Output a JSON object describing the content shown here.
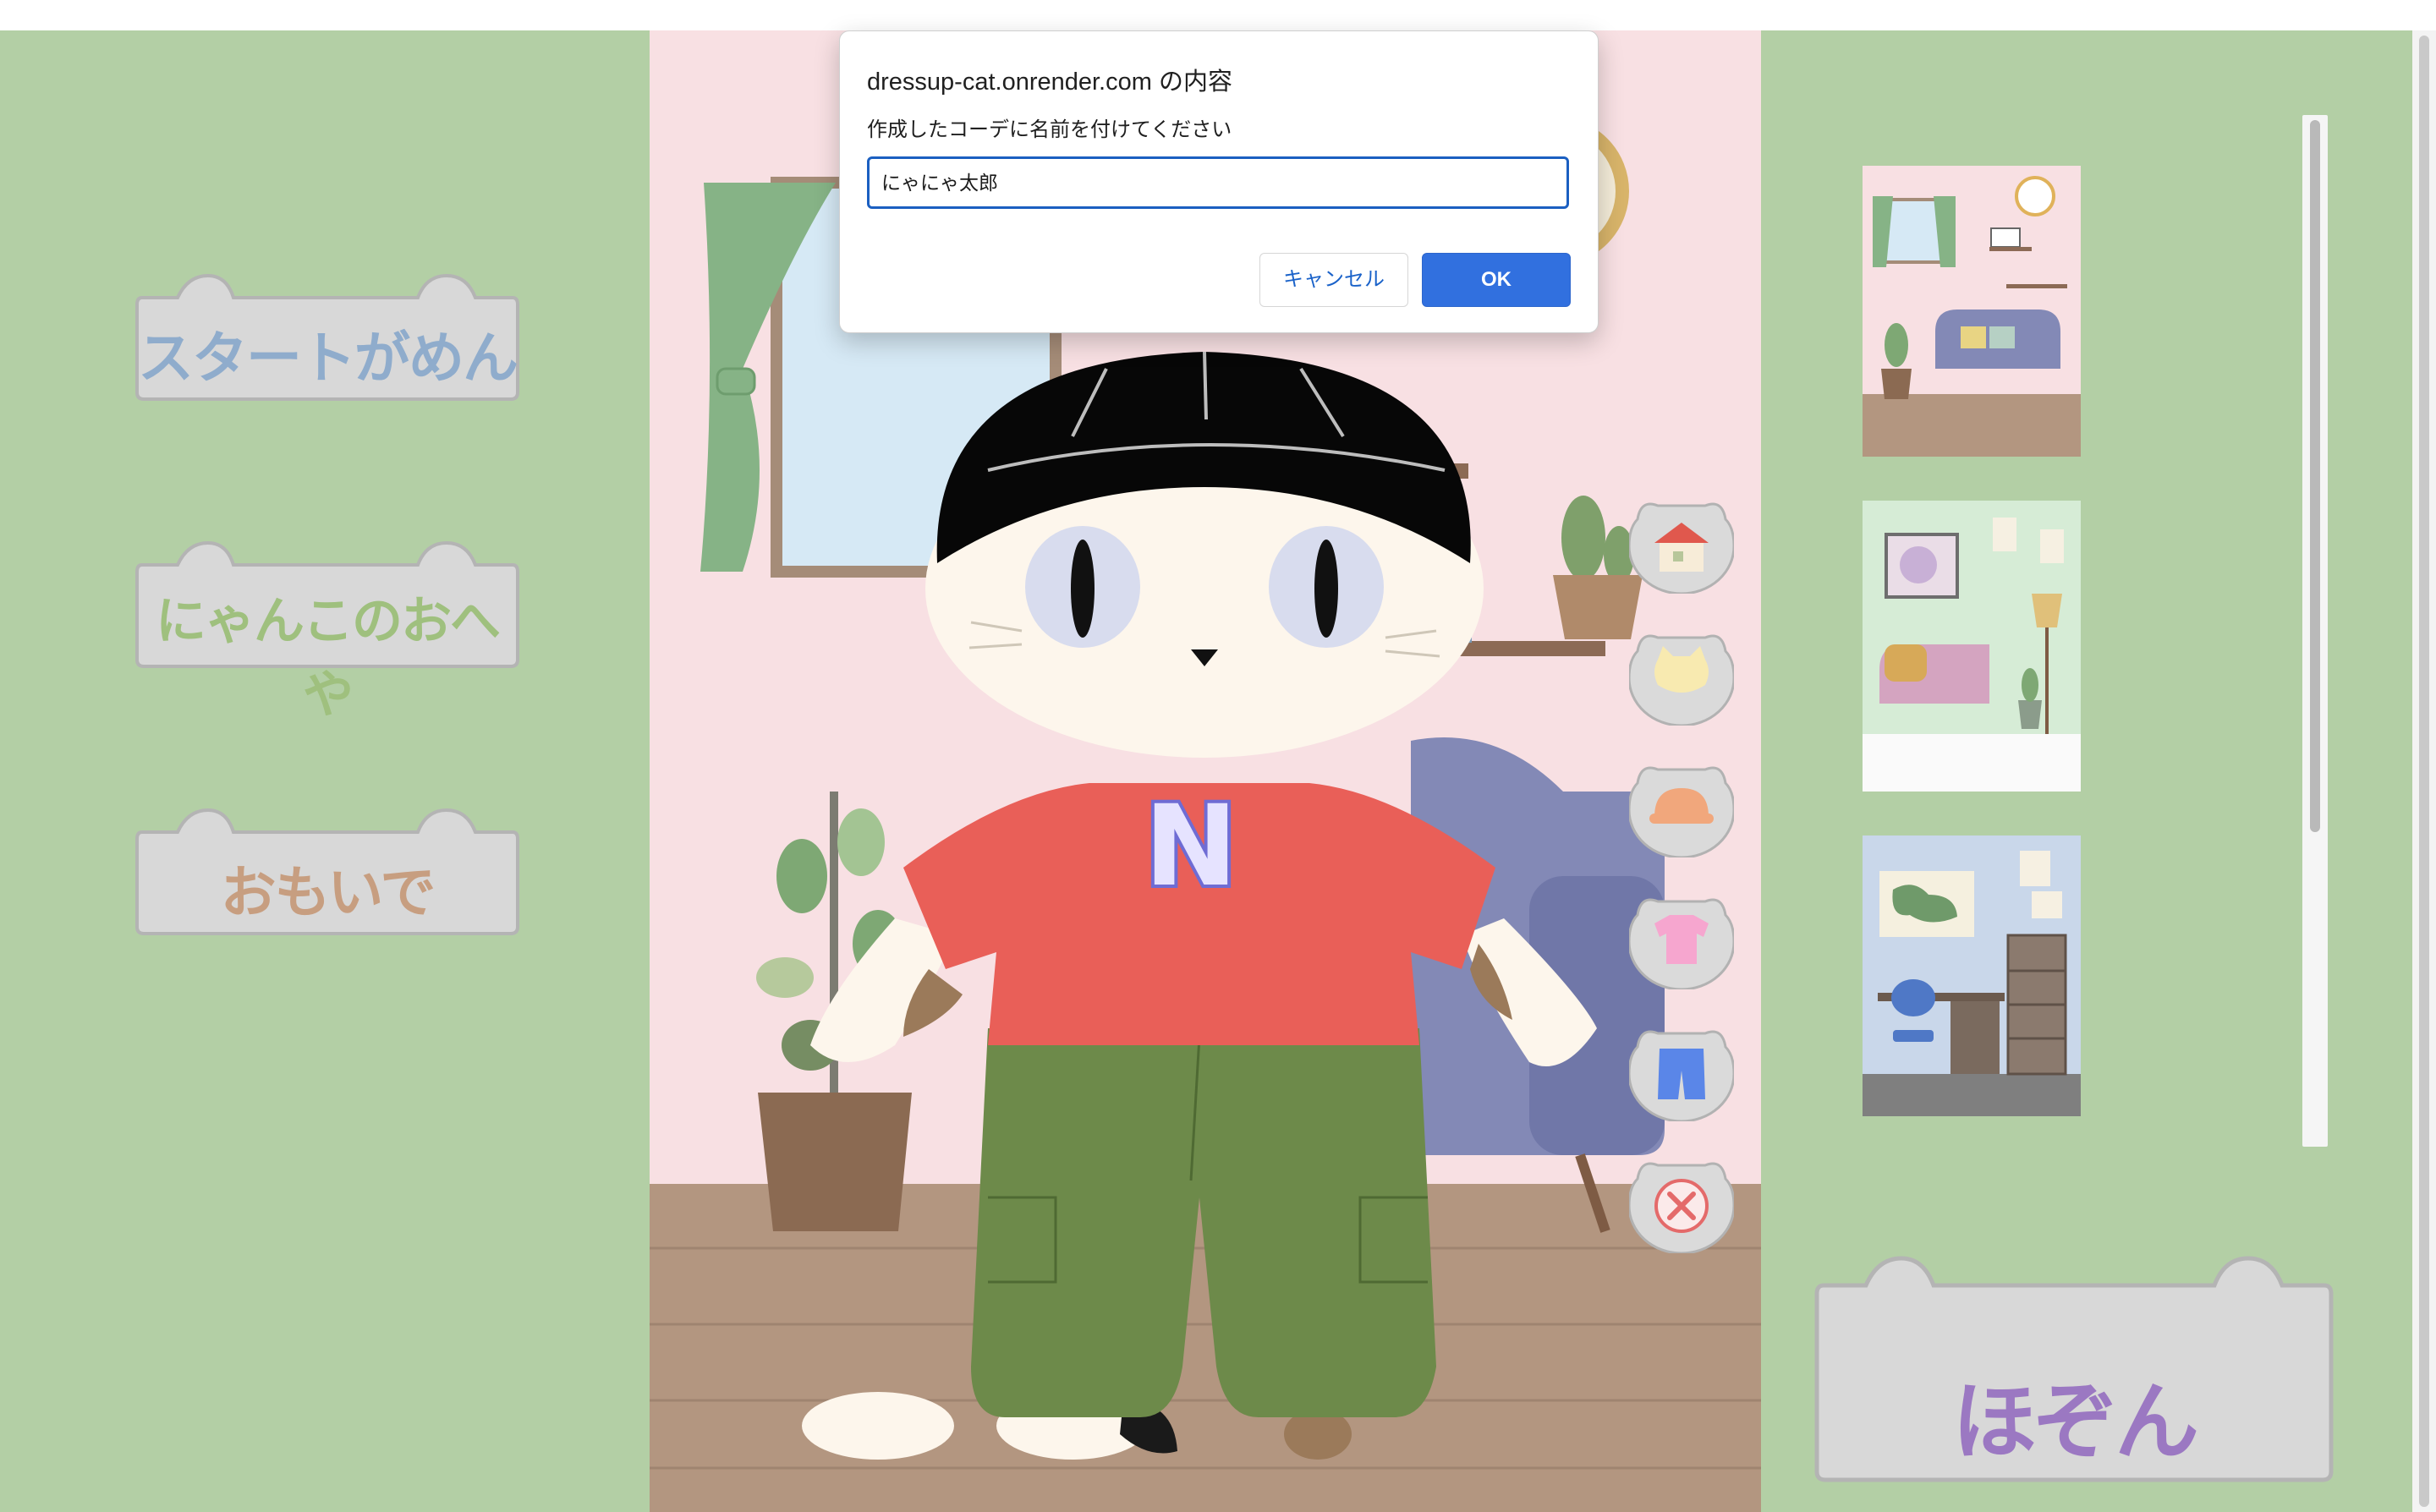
{
  "dialog": {
    "title": "dressup-cat.onrender.com の内容",
    "message": "作成したコーデに名前を付けてください",
    "input_value": "にゃにゃ太郎",
    "cancel_label": "キャンセル",
    "ok_label": "OK"
  },
  "nav": {
    "buttons": [
      {
        "label": "スタートがめん",
        "color": "#8faccc"
      },
      {
        "label": "にゃんこのおへや",
        "color": "#9fc07e"
      },
      {
        "label": "おもいで",
        "color": "#c79e80"
      }
    ]
  },
  "shirt": {
    "logo": "N"
  },
  "category_icons": [
    "house-icon",
    "cat-face-icon",
    "hat-icon",
    "shirt-icon",
    "shorts-icon",
    "close-icon"
  ],
  "backgrounds": [
    {
      "name": "living-room-thumbnail"
    },
    {
      "name": "green-room-thumbnail"
    },
    {
      "name": "study-room-thumbnail"
    }
  ],
  "save": {
    "label": "ほぞん",
    "color": "#9b78c2"
  },
  "colors": {
    "app_bg": "#b3cfa5",
    "stage_bg": "#f8e0e3",
    "button_bg": "#d8d8d8",
    "ok_blue": "#3170df"
  }
}
